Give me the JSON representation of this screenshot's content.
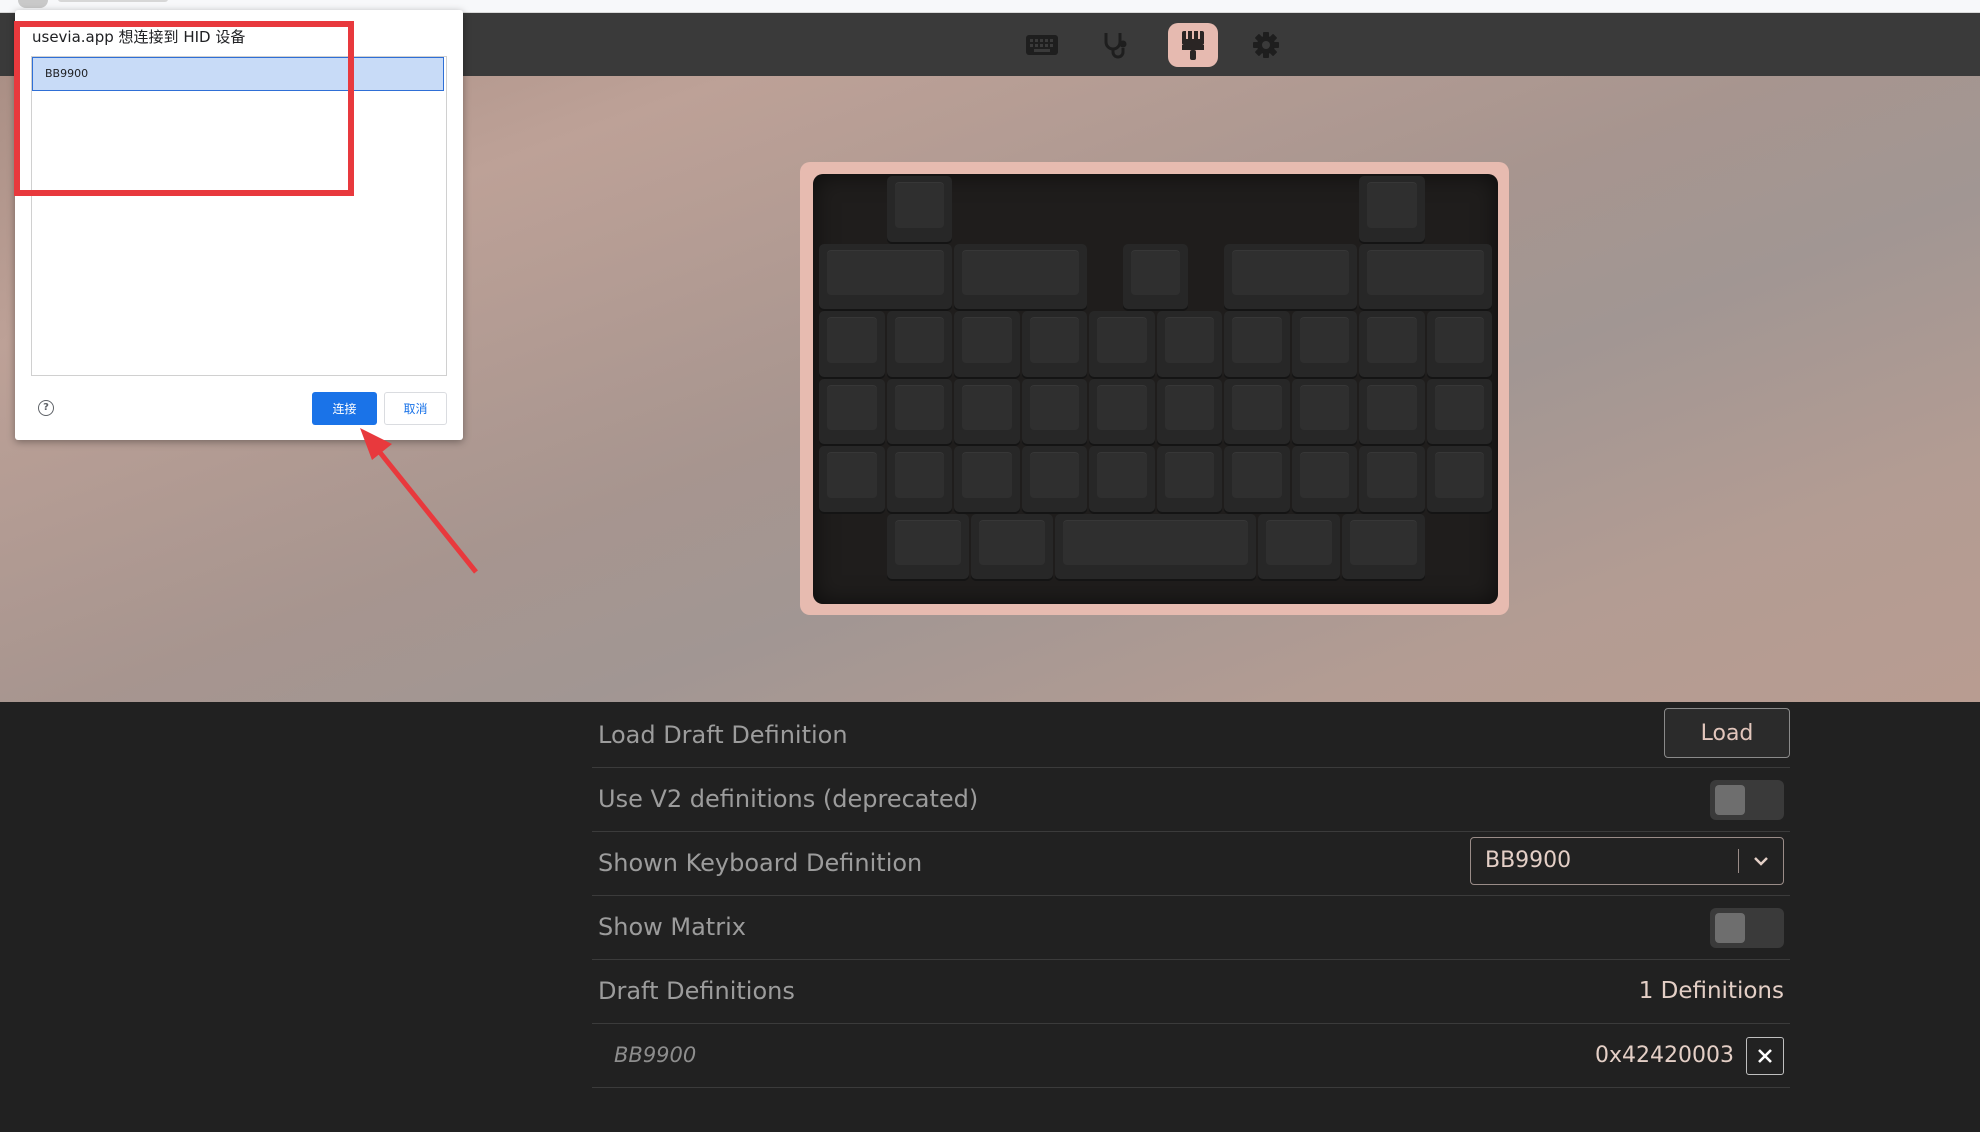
{
  "app_header": {
    "nav": [
      {
        "name": "keyboard-icon",
        "active": false
      },
      {
        "name": "stethoscope-icon",
        "active": false
      },
      {
        "name": "paintbrush-icon",
        "active": true
      },
      {
        "name": "gear-icon",
        "active": false
      }
    ],
    "accent_color": "#e6bab0"
  },
  "dialog": {
    "title": "usevia.app 想连接到 HID 设备",
    "devices": [
      "BB9900"
    ],
    "selected_device": "BB9900",
    "help_icon": "question-circle-icon",
    "connect_label": "连接",
    "cancel_label": "取消",
    "connect_color": "#1a73e8"
  },
  "annotation": {
    "box_color": "#e8393d"
  },
  "settings": {
    "load_draft": {
      "label": "Load Draft Definition",
      "button": "Load"
    },
    "use_v2": {
      "label": "Use V2 definitions (deprecated)",
      "enabled": false
    },
    "shown_definition": {
      "label": "Shown Keyboard Definition",
      "value": "BB9900"
    },
    "show_matrix": {
      "label": "Show Matrix",
      "enabled": false
    },
    "draft_definitions": {
      "label": "Draft Definitions",
      "count_text": "1 Definitions"
    },
    "definition_entry": {
      "name": "BB9900",
      "vendor_product_id": "0x42420003",
      "remove_icon": "close-icon"
    }
  }
}
